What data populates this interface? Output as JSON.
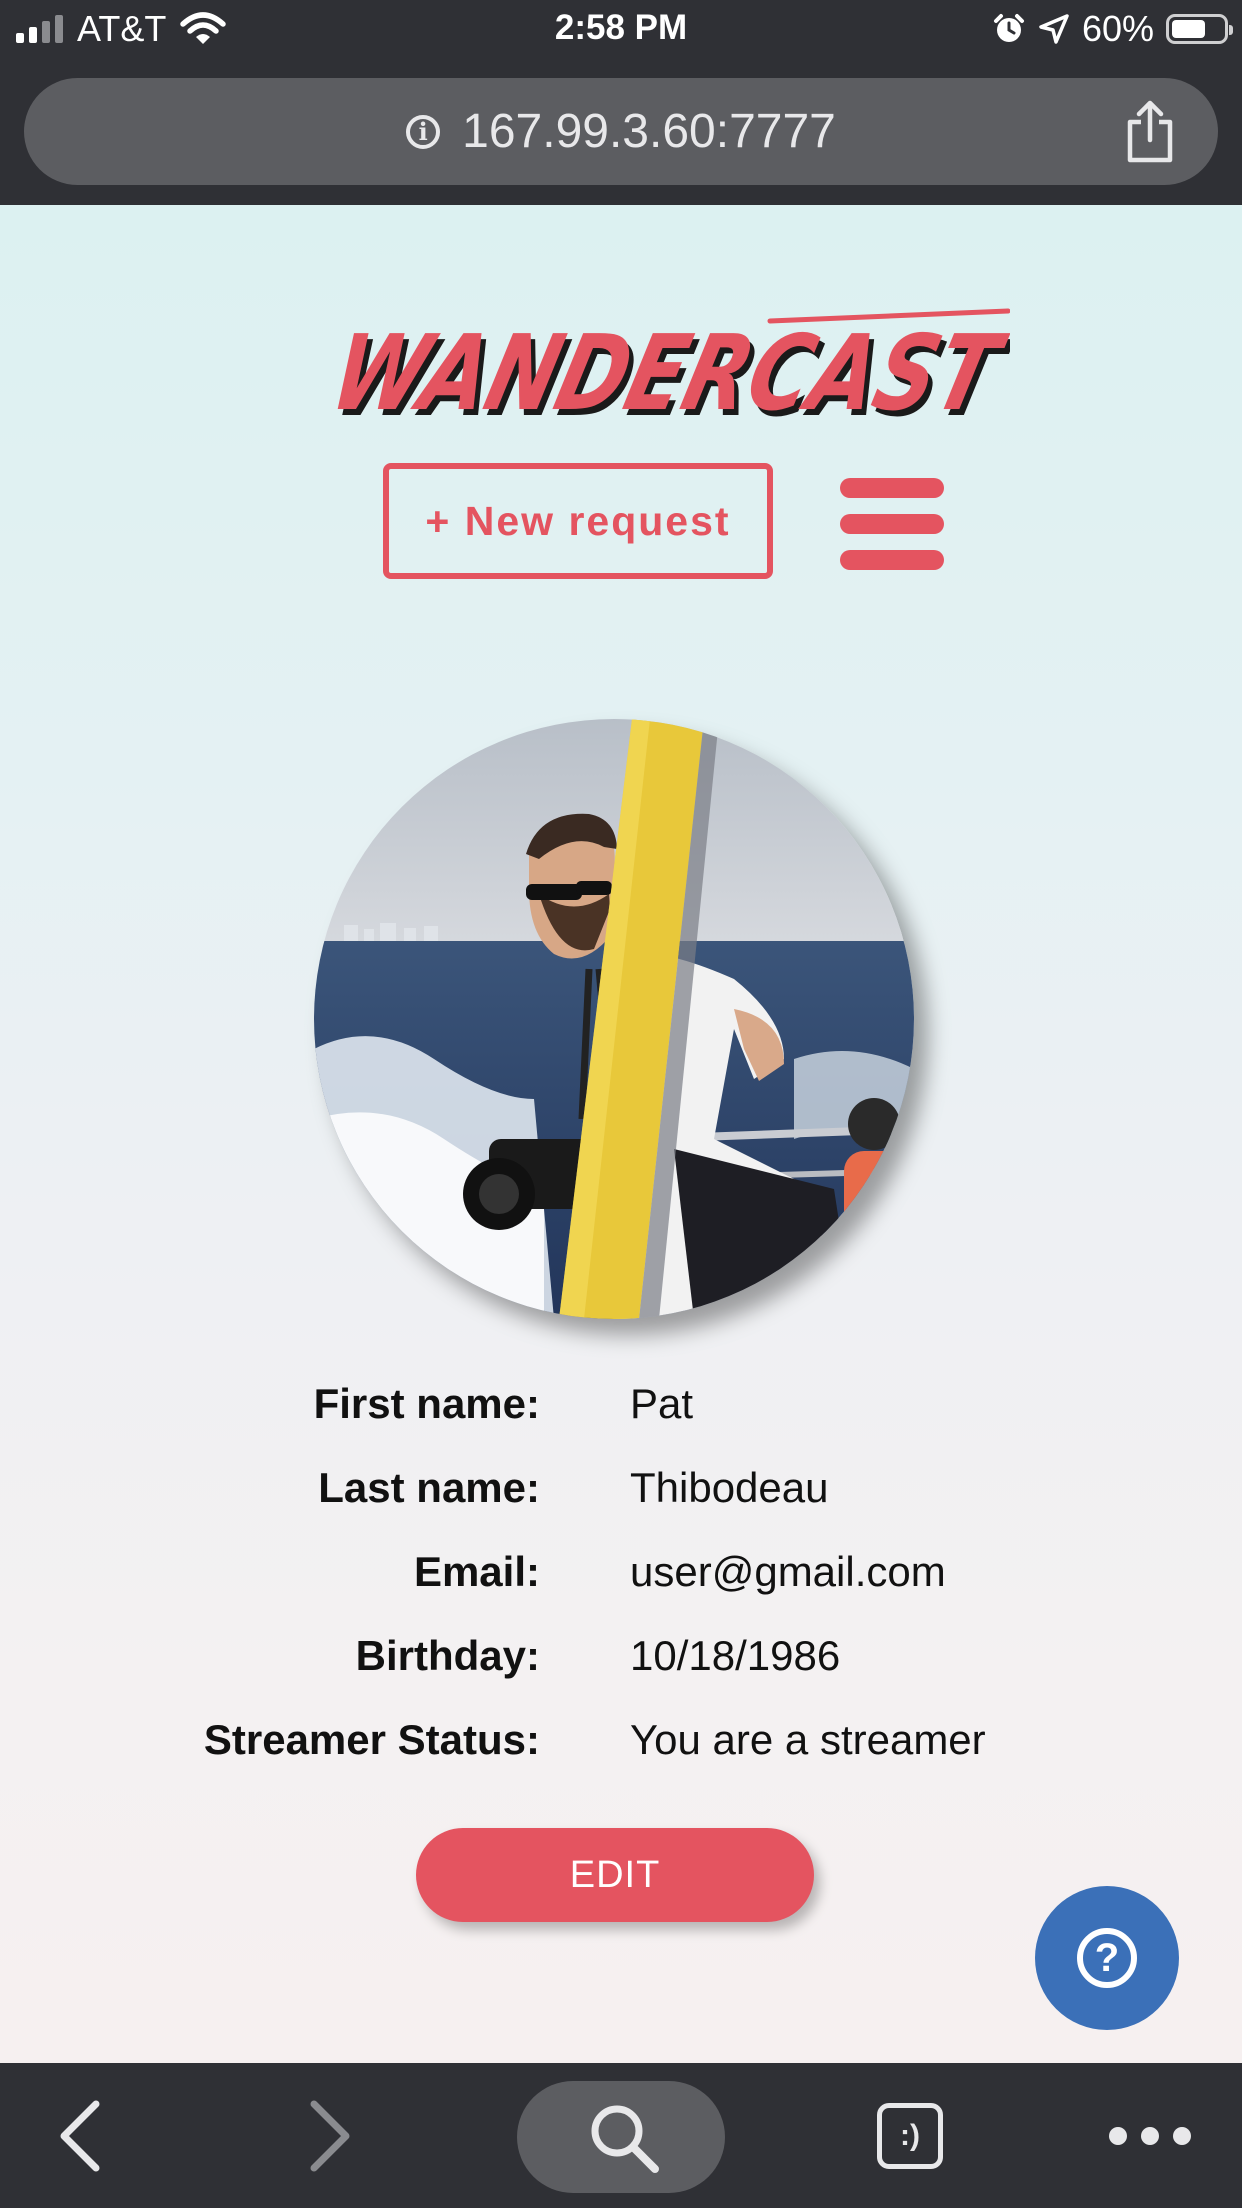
{
  "status_bar": {
    "carrier": "AT&T",
    "time": "2:58 PM",
    "battery_percent": "60%",
    "battery_level": 0.6,
    "icons": [
      "signal-icon",
      "wifi-icon",
      "alarm-icon",
      "location-icon",
      "battery-icon"
    ]
  },
  "browser": {
    "url": "167.99.3.60:7777",
    "info_icon_glyph": "i",
    "icons": [
      "info-icon",
      "share-icon"
    ]
  },
  "header": {
    "logo_text": "WANDERCAST",
    "new_request_label": "+ New request",
    "menu_icon": "hamburger-menu-icon"
  },
  "profile": {
    "fields": [
      {
        "label": "First name:",
        "value": "Pat"
      },
      {
        "label": "Last name:",
        "value": "Thibodeau"
      },
      {
        "label": "Email:",
        "value": "user@gmail.com"
      },
      {
        "label": "Birthday:",
        "value": "10/18/1986"
      },
      {
        "label": "Streamer Status:",
        "value": "You are a streamer"
      }
    ],
    "edit_label": "EDIT"
  },
  "help": {
    "glyph": "?"
  },
  "toolbar": {
    "icons": [
      "back-icon",
      "forward-icon",
      "search-icon",
      "tabs-icon",
      "more-icon"
    ],
    "tabs_glyph": ":)"
  },
  "colors": {
    "accent": "#e45460",
    "help_blue": "#3b70b8",
    "chrome_dark": "#2f3035",
    "chrome_pill": "#5c5d61"
  }
}
